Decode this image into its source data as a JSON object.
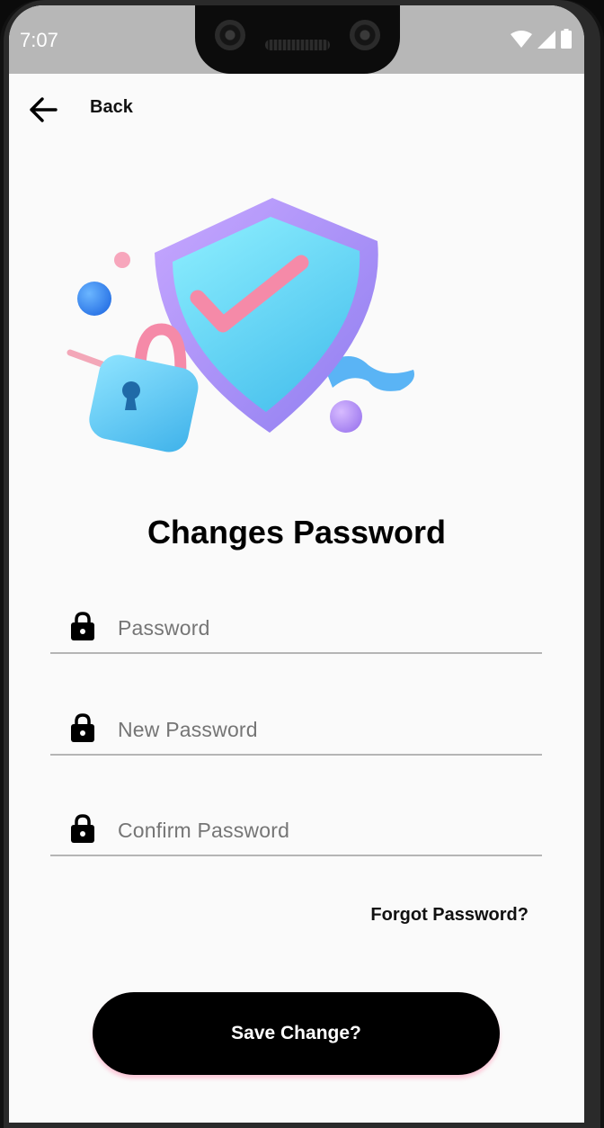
{
  "status_bar": {
    "time": "7:07",
    "icons": [
      "wifi-icon",
      "signal-icon",
      "battery-icon"
    ]
  },
  "header": {
    "back_icon": "arrow-left-icon",
    "back_label": "Back"
  },
  "illustration": {
    "name": "shield-lock-illustration"
  },
  "title": "Changes Password",
  "form": {
    "fields": [
      {
        "icon": "lock-icon",
        "placeholder": "Password"
      },
      {
        "icon": "lock-icon",
        "placeholder": "New Password"
      },
      {
        "icon": "lock-icon",
        "placeholder": "Confirm Password"
      }
    ],
    "forgot_label": "Forgot Password?",
    "save_label": "Save Change?"
  },
  "colors": {
    "background": "#fafafa",
    "status_bar": "#b7b7b7",
    "button": "#000000",
    "placeholder": "#757575"
  }
}
